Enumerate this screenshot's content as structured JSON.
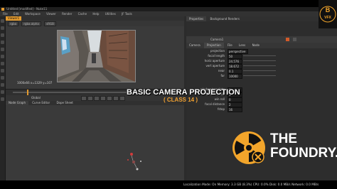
{
  "window": {
    "title": "Untitled [modified] - Nuke11"
  },
  "menu": [
    "File",
    "Edit",
    "Workspace",
    "Viewer",
    "Render",
    "Cache",
    "Help",
    "Utilities",
    "JF Tools"
  ],
  "viewer": {
    "tab_label": "Viewer1",
    "channels": "rgba",
    "layer": "rgba.alpha",
    "colorspace": "sRGB",
    "info": "1000x66  x=1329 y=107",
    "playback_mode": "Global"
  },
  "node_graph": {
    "tabs": [
      "Node Graph",
      "Curve Editor",
      "Dope Sheet"
    ]
  },
  "properties": {
    "tabs": [
      "Properties",
      "Background Renders"
    ],
    "node_name": "Camera1",
    "subtabs": [
      "Camera",
      "Projection",
      "File",
      "Lens",
      "Node"
    ],
    "active_subtab": "Projection",
    "rows": [
      {
        "label": "projection",
        "value": "perspective"
      },
      {
        "label": "focal length",
        "value": "50"
      },
      {
        "label": "horiz aperture",
        "value": "24.576"
      },
      {
        "label": "vert aperture",
        "value": "18.672"
      },
      {
        "label": "near",
        "value": "0.1"
      },
      {
        "label": "far",
        "value": "10000"
      },
      {
        "label": "window translate",
        "value": "0"
      },
      {
        "label": "window scale",
        "value": "1"
      },
      {
        "label": "win roll",
        "value": "0"
      },
      {
        "label": "focal distance",
        "value": "2"
      },
      {
        "label": "fstop",
        "value": "16"
      }
    ]
  },
  "overlay": {
    "title": "BASIC CAMERA PROJECTION",
    "subtitle": "( CLASS 14 )"
  },
  "brand": {
    "line1": "THE",
    "line2": "FOUNDRY.",
    "corner_logo_letters": "B VFX",
    "accent_color": "#f2a52b"
  },
  "status": {
    "text": "Localization Mode: On  Memory: 3.3 GB (8.3%)  CPU: 0.0%  Disk: 0.0 MB/s  Network: 0.0 MB/s"
  }
}
